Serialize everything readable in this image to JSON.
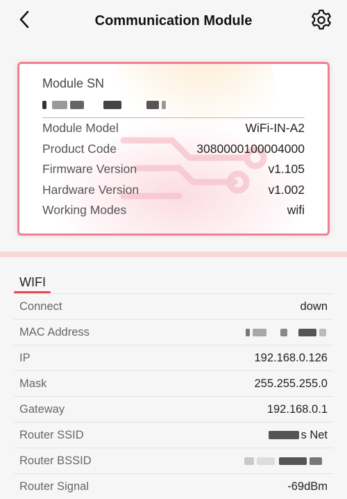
{
  "header": {
    "title": "Communication Module",
    "back_icon": "back-arrow-icon",
    "settings_icon": "gear-icon"
  },
  "module_card": {
    "sn_label": "Module SN",
    "sn_value_redacted": true,
    "rows": [
      {
        "label": "Module Model",
        "value": "WiFi-IN-A2"
      },
      {
        "label": "Product Code",
        "value": "3080000100004000"
      },
      {
        "label": "Firmware Version",
        "value": "v1.105"
      },
      {
        "label": "Hardware Version",
        "value": "v1.002"
      },
      {
        "label": "Working Modes",
        "value": "wifi"
      }
    ],
    "border_color": "#ef7f92"
  },
  "wifi": {
    "title": "WIFI",
    "accent": "#e8464f",
    "rows": [
      {
        "label": "Connect",
        "value": "down"
      },
      {
        "label": "MAC Address",
        "value": ""
      },
      {
        "label": "IP",
        "value": "192.168.0.126"
      },
      {
        "label": "Mask",
        "value": "255.255.255.0"
      },
      {
        "label": "Gateway",
        "value": "192.168.0.1"
      },
      {
        "label": "Router SSID",
        "value": "s Net"
      },
      {
        "label": "Router BSSID",
        "value": ""
      },
      {
        "label": "Router Signal",
        "value": "-69dBm"
      }
    ]
  }
}
